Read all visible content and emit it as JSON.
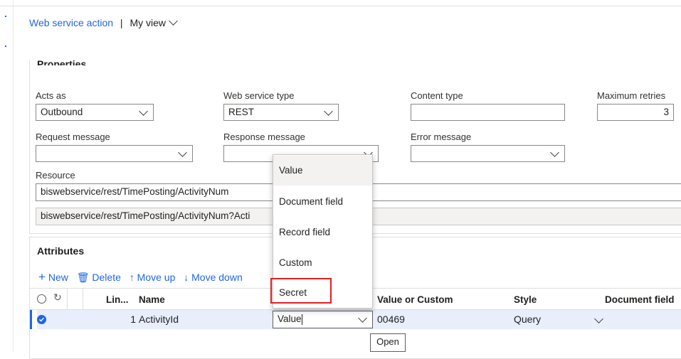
{
  "header": {
    "breadcrumb_link": "Web service action",
    "separator": "|",
    "view_label": "My view"
  },
  "properties": {
    "title": "Properties",
    "acts_as": {
      "label": "Acts as",
      "value": "Outbound"
    },
    "web_service_type": {
      "label": "Web service type",
      "value": "REST"
    },
    "content_type": {
      "label": "Content type",
      "value": ""
    },
    "maximum_retries": {
      "label": "Maximum retries",
      "value": "3"
    },
    "request_message": {
      "label": "Request message",
      "value": ""
    },
    "response_message": {
      "label": "Response message",
      "value": ""
    },
    "error_message": {
      "label": "Error message",
      "value": ""
    },
    "resource": {
      "label": "Resource",
      "value": "biswebservice/rest/TimePosting/ActivityNum",
      "resolved": "biswebservice/rest/TimePosting/ActivityNum?Acti"
    }
  },
  "attributes": {
    "title": "Attributes",
    "toolbar": {
      "new": "New",
      "delete": "Delete",
      "move_up": "Move up",
      "move_down": "Move down"
    },
    "columns": {
      "line": "Lin...",
      "name": "Name",
      "value_or_custom": "Value or Custom",
      "style": "Style",
      "document_field": "Document field"
    },
    "rows": [
      {
        "line": "1",
        "name": "ActivityId",
        "source": "Value",
        "value_or_custom": "00469",
        "style": "Query"
      }
    ]
  },
  "dropdown": {
    "items": [
      "Value",
      "Document field",
      "Record field",
      "Custom",
      "Secret"
    ],
    "selected": "Value",
    "highlighted": "Secret"
  },
  "tooltip": "Open",
  "colors": {
    "accent": "#2266e3",
    "highlight_box": "#e31e24"
  }
}
